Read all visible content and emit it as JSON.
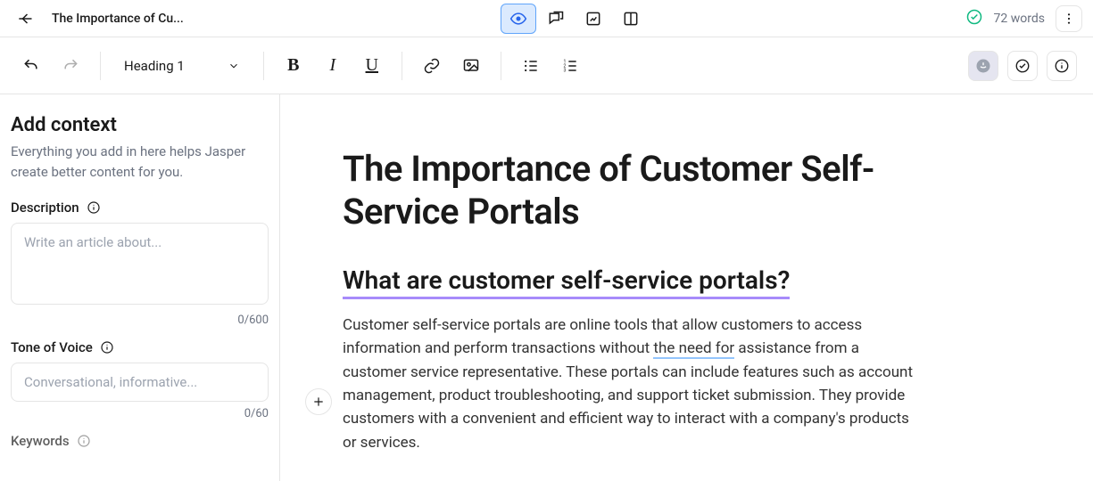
{
  "header": {
    "doc_title_short": "The Importance of Cu...",
    "word_count": "72 words"
  },
  "toolbar": {
    "style_label": "Heading 1"
  },
  "sidebar": {
    "title": "Add context",
    "subtitle": "Everything you add in here helps Jasper create better content for you.",
    "description_label": "Description",
    "description_placeholder": "Write an article about...",
    "description_value": "",
    "description_counter": "0/600",
    "tone_label": "Tone of Voice",
    "tone_placeholder": "Conversational, informative...",
    "tone_value": "",
    "tone_counter": "0/60",
    "keywords_label": "Keywords"
  },
  "document": {
    "title": "The Importance of Customer Self-Service Portals",
    "h2": "What are customer self-service portals?",
    "body_before": " Customer self-service portals are online tools that allow customers to access information and perform transactions without ",
    "body_underlined": "the need for",
    "body_after": " assistance from a customer service representative. These portals can include features such as account management, product troubleshooting, and support ticket submission. They provide customers with a convenient and efficient way to interact with a company's products or services."
  }
}
